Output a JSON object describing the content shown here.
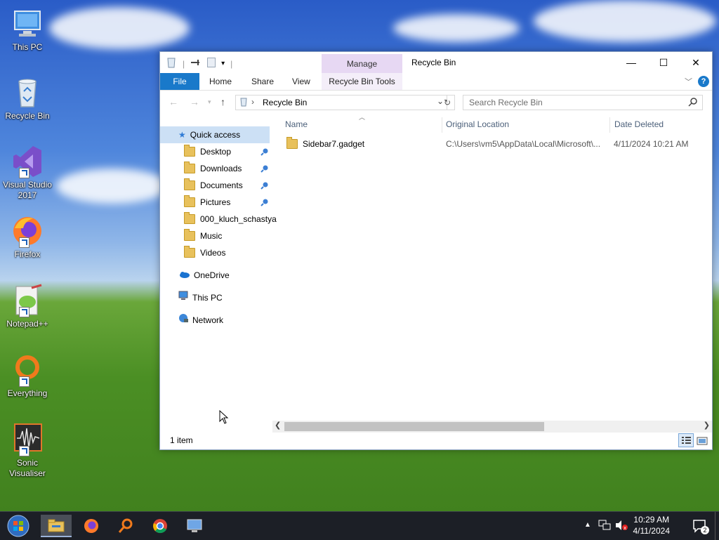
{
  "desktop": {
    "icons": [
      {
        "label": "This PC"
      },
      {
        "label": "Recycle Bin"
      },
      {
        "label": "Visual Studio 2017"
      },
      {
        "label": "Firefox"
      },
      {
        "label": "Notepad++"
      },
      {
        "label": "Everything"
      },
      {
        "label": "Sonic Visualiser"
      }
    ]
  },
  "window": {
    "title": "Recycle Bin",
    "manage_tab": "Manage",
    "ribbon_tabs": {
      "file": "File",
      "home": "Home",
      "share": "Share",
      "view": "View",
      "tools": "Recycle Bin Tools"
    },
    "address": {
      "path": "Recycle Bin"
    },
    "search": {
      "placeholder": "Search Recycle Bin"
    },
    "nav": {
      "quick_access": "Quick access",
      "desktop": "Desktop",
      "downloads": "Downloads",
      "documents": "Documents",
      "pictures": "Pictures",
      "kluch": "000_kluch_schastya",
      "music": "Music",
      "videos": "Videos",
      "onedrive": "OneDrive",
      "thispc": "This PC",
      "network": "Network"
    },
    "columns": {
      "name": "Name",
      "location": "Original Location",
      "deleted": "Date Deleted"
    },
    "rows": [
      {
        "name": "Sidebar7.gadget",
        "location": "C:\\Users\\vm5\\AppData\\Local\\Microsoft\\...",
        "deleted": "4/11/2024 10:21 AM"
      }
    ],
    "status": "1 item"
  },
  "taskbar": {
    "time": "10:29 AM",
    "date": "4/11/2024",
    "notifications": "2"
  }
}
